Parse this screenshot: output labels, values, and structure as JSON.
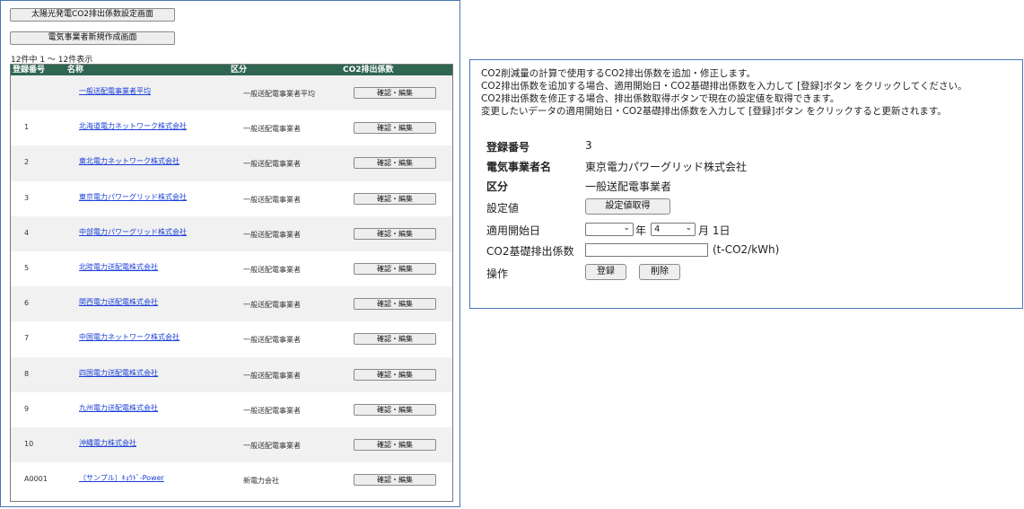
{
  "left": {
    "btn_pv": "太陽光発電CO2排出係数設定画面",
    "btn_new": "電気事業者新規作成画面",
    "count_text": "12件中 1 ～ 12件表示",
    "headers": {
      "no": "登録番号",
      "name": "名称",
      "kubun": "区分",
      "co2": "CO2排出係数"
    },
    "rows": [
      {
        "no": "",
        "name": "一般送配電事業者平均",
        "kubun": "一般送配電事業者平均",
        "action": "確認・編集"
      },
      {
        "no": "1",
        "name": "北海道電力ネットワーク株式会社",
        "kubun": "一般送配電事業者",
        "action": "確認・編集"
      },
      {
        "no": "2",
        "name": "東北電力ネットワーク株式会社",
        "kubun": "一般送配電事業者",
        "action": "確認・編集"
      },
      {
        "no": "3",
        "name": "東京電力パワーグリッド株式会社",
        "kubun": "一般送配電事業者",
        "action": "確認・編集"
      },
      {
        "no": "4",
        "name": "中部電力パワーグリッド株式会社",
        "kubun": "一般送配電事業者",
        "action": "確認・編集"
      },
      {
        "no": "5",
        "name": "北陸電力送配電株式会社",
        "kubun": "一般送配電事業者",
        "action": "確認・編集"
      },
      {
        "no": "6",
        "name": "関西電力送配電株式会社",
        "kubun": "一般送配電事業者",
        "action": "確認・編集"
      },
      {
        "no": "7",
        "name": "中国電力ネットワーク株式会社",
        "kubun": "一般送配電事業者",
        "action": "確認・編集"
      },
      {
        "no": "8",
        "name": "四国電力送配電株式会社",
        "kubun": "一般送配電事業者",
        "action": "確認・編集"
      },
      {
        "no": "9",
        "name": "九州電力送配電株式会社",
        "kubun": "一般送配電事業者",
        "action": "確認・編集"
      },
      {
        "no": "10",
        "name": "沖縄電力株式会社",
        "kubun": "一般送配電事業者",
        "action": "確認・編集"
      },
      {
        "no": "A0001",
        "name": "（サンプル）ｷｮｳﾄﾞ-Power",
        "kubun": "新電力会社",
        "action": "確認・編集"
      }
    ]
  },
  "right": {
    "intro": [
      "CO2削減量の計算で使用するCO2排出係数を追加・修正します。",
      "CO2排出係数を追加する場合、適用開始日・CO2基礎排出係数を入力して [登録]ボタン をクリックしてください。",
      "CO2排出係数を修正する場合、排出係数取得ボタンで現在の設定値を取得できます。",
      "変更したいデータの適用開始日・CO2基礎排出係数を入力して [登録]ボタン をクリックすると更新されます。"
    ],
    "labels": {
      "reg_no": "登録番号",
      "company": "電気事業者名",
      "kubun": "区分",
      "setting": "設定値",
      "start_date": "適用開始日",
      "co2_factor": "CO2基礎排出係数",
      "operation": "操作"
    },
    "values": {
      "reg_no": "3",
      "company": "東京電力パワーグリッド株式会社",
      "kubun": "一般送配電事業者"
    },
    "btn_get": "設定値取得",
    "year_select": "",
    "year_suffix": "年",
    "month_select": "4",
    "month_suffix": "月 1日",
    "co2_input_value": "",
    "co2_unit": "(t-CO2/kWh)",
    "btn_register": "登録",
    "btn_delete": "削除"
  }
}
